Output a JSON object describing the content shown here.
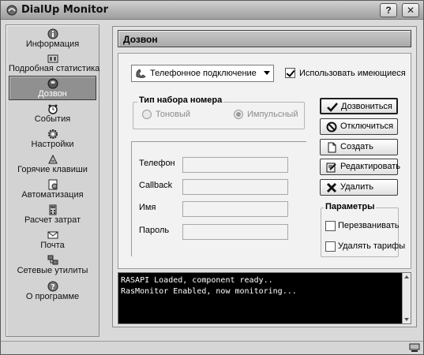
{
  "window": {
    "title": "DialUp Monitor",
    "help_label": "?",
    "close_label": "✕"
  },
  "sidebar": {
    "items": [
      {
        "label": "Информация",
        "icon": "info-icon"
      },
      {
        "label": "Подробная статистика",
        "icon": "statistics-icon"
      },
      {
        "label": "Дозвон",
        "icon": "phone-icon",
        "active": true
      },
      {
        "label": "События",
        "icon": "alarm-clock-icon"
      },
      {
        "label": "Настройки",
        "icon": "gear-icon"
      },
      {
        "label": "Горячие клавиши",
        "icon": "hotkeys-icon"
      },
      {
        "label": "Автоматизация",
        "icon": "automation-icon"
      },
      {
        "label": "Расчет затрат",
        "icon": "calculator-icon"
      },
      {
        "label": "Почта",
        "icon": "mail-icon"
      },
      {
        "label": "Сетевые утилиты",
        "icon": "network-icon"
      },
      {
        "label": "О программе",
        "icon": "help-icon"
      }
    ]
  },
  "main": {
    "header": "Дозвон",
    "connection_select": "Телефонное подключение",
    "use_existing": {
      "label": "Использовать имеющиеся",
      "checked": true
    },
    "dial_type": {
      "title": "Тип набора номера",
      "tone": "Тоновый",
      "pulse": "Импульсный",
      "selected": "pulse"
    },
    "fields": {
      "phone": "Телефон",
      "callback": "Callback",
      "name": "Имя",
      "password": "Пароль"
    },
    "buttons": {
      "dial": "Дозвониться",
      "disconnect": "Отключиться",
      "create": "Создать",
      "edit": "Редактировать",
      "delete": "Удалить"
    },
    "params": {
      "title": "Параметры",
      "redial": {
        "label": "Перезванивать",
        "checked": false
      },
      "delete_tariffs": {
        "label": "Удалять тарифы",
        "checked": false
      }
    }
  },
  "console": {
    "lines": [
      "RASAPI Loaded, component ready..",
      "RasMonitor Enabled, now monitoring..."
    ]
  }
}
